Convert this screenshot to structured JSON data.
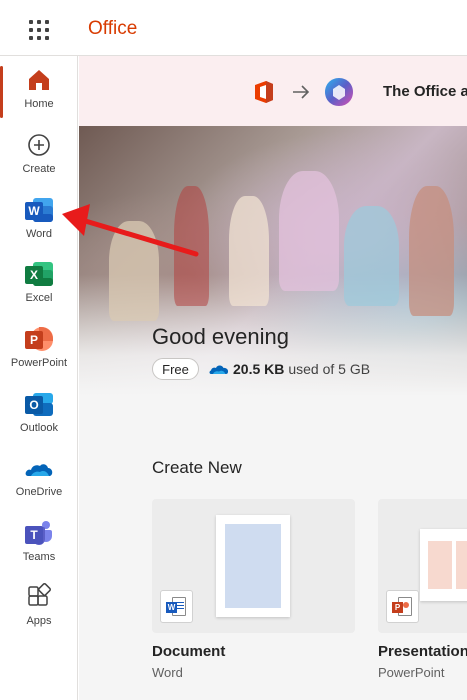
{
  "app": {
    "brand": "Office"
  },
  "rail": {
    "items": [
      {
        "label": "Home",
        "icon": "home-icon",
        "active": true
      },
      {
        "label": "Create",
        "icon": "add-circle-icon"
      },
      {
        "label": "Word",
        "icon": "word-icon"
      },
      {
        "label": "Excel",
        "icon": "excel-icon"
      },
      {
        "label": "PowerPoint",
        "icon": "powerpoint-icon"
      },
      {
        "label": "Outlook",
        "icon": "outlook-icon"
      },
      {
        "label": "OneDrive",
        "icon": "onedrive-icon"
      },
      {
        "label": "Teams",
        "icon": "teams-icon"
      },
      {
        "label": "Apps",
        "icon": "apps-icon"
      }
    ]
  },
  "banner": {
    "text": "The Office a"
  },
  "hero": {
    "greeting": "Good evening",
    "plan_badge": "Free",
    "storage_used": "20.5 KB",
    "storage_rest": "used of 5 GB"
  },
  "create_new": {
    "title": "Create New",
    "cards": [
      {
        "name": "Document",
        "app": "Word"
      },
      {
        "name": "Presentation",
        "app": "PowerPoint"
      }
    ]
  },
  "colors": {
    "accent": "#c43e1c",
    "brand": "#d83b01",
    "word": "#185abd",
    "excel": "#107c41",
    "powerpoint": "#c43e1c",
    "outlook": "#0f6cbd",
    "onedrive": "#0364b8",
    "teams": "#5b5fc7",
    "annotation_arrow": "#e81b1b"
  }
}
